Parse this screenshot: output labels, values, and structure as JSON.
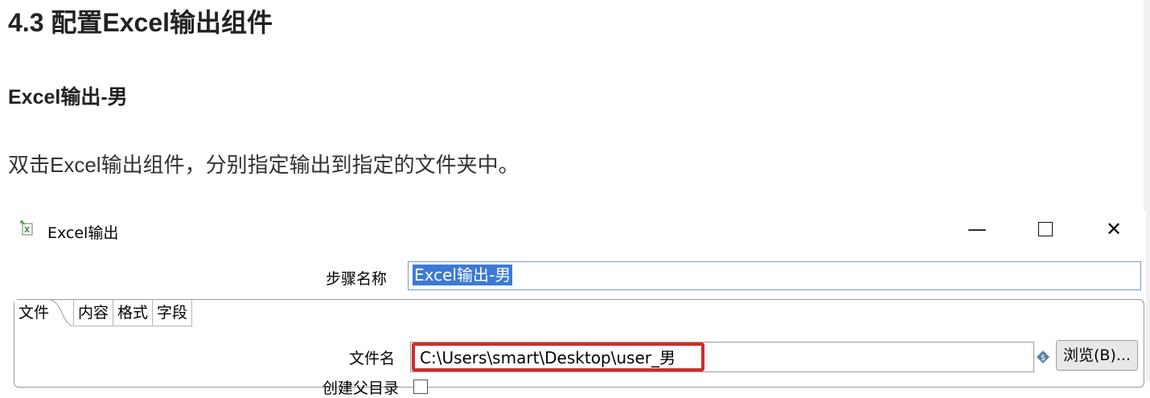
{
  "doc": {
    "section_heading": "4.3 配置Excel输出组件",
    "subheading": "Excel输出-男",
    "paragraph": "双击Excel输出组件，分别指定输出到指定的文件夹中。"
  },
  "dialog": {
    "title": "Excel输出",
    "title_icon": "excel-output-icon",
    "window_controls": {
      "minimize": "—",
      "close": "✕"
    },
    "step_name_label": "步骤名称",
    "step_name_value": "Excel输出-男",
    "tabs": [
      {
        "label": "文件",
        "active": true
      },
      {
        "label": "内容",
        "active": false
      },
      {
        "label": "格式",
        "active": false
      },
      {
        "label": "字段",
        "active": false
      }
    ],
    "filename_label": "文件名",
    "filename_value": "C:\\Users\\smart\\Desktop\\user_男",
    "variable_icon": "variable-diamond-icon",
    "browse_label": "浏览(B)...",
    "create_parent_label": "创建父目录",
    "highlight_color": "#d32a2a",
    "selection_color": "#3c79d6"
  }
}
